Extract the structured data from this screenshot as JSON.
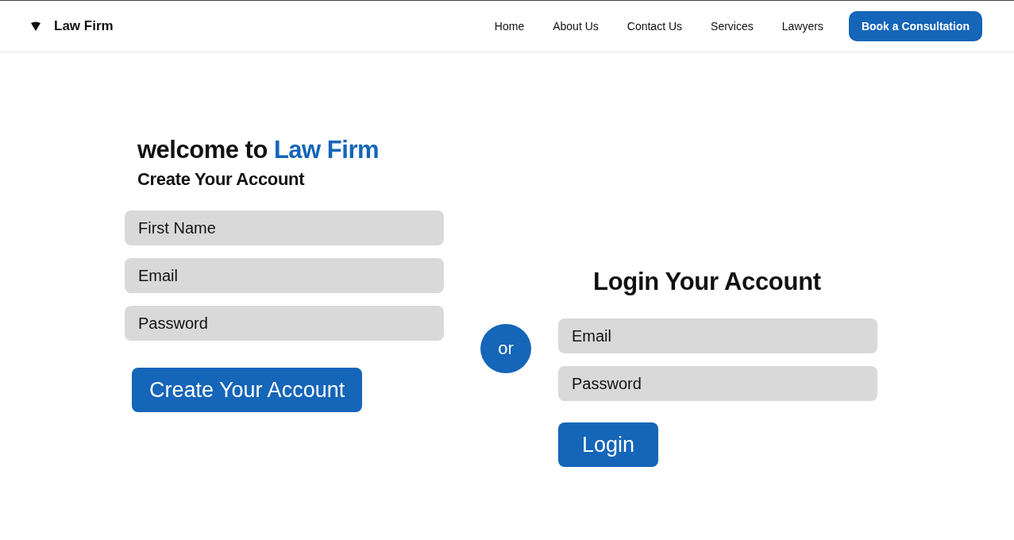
{
  "header": {
    "brand": "Law Firm",
    "nav": [
      {
        "label": "Home"
      },
      {
        "label": "About Us"
      },
      {
        "label": "Contact Us"
      },
      {
        "label": "Services"
      },
      {
        "label": "Lawyers"
      }
    ],
    "cta": "Book a Consultation"
  },
  "signup": {
    "welcome": "welcome to",
    "brand": "Law Firm",
    "title": "Create Your Account",
    "fields": [
      {
        "placeholder": "First Name"
      },
      {
        "placeholder": "Email"
      },
      {
        "placeholder": "Password"
      }
    ],
    "button": "Create Your Account"
  },
  "divider": "or",
  "login": {
    "title": "Login Your Account",
    "fields": [
      {
        "placeholder": "Email"
      },
      {
        "placeholder": "Password"
      }
    ],
    "button": "Login"
  }
}
